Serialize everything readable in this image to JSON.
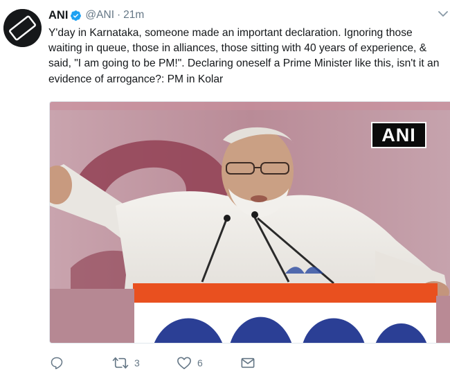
{
  "tweet": {
    "author_name": "ANI",
    "handle": "@ANI",
    "separator": "·",
    "time": "21m",
    "text_lines": [
      "Y'day in Karnataka, someone made an important declaration. Ignoring those",
      "waiting in queue, those in alliances, those sitting with 40 years of experience, &",
      "said, \"I am going to be PM!\". Declaring oneself a Prime Minister like this, isn't it an",
      "evidence of arrogance?: PM in Kolar"
    ],
    "media": {
      "watermark": "ANI"
    },
    "actions": {
      "reply_icon": "reply-icon",
      "retweet_icon": "retweet-icon",
      "retweet_count": "3",
      "like_icon": "heart-icon",
      "like_count": "6",
      "message_icon": "envelope-icon"
    },
    "colors": {
      "text": "#14171a",
      "secondary": "#657786",
      "verified": "#1da1f2"
    }
  }
}
